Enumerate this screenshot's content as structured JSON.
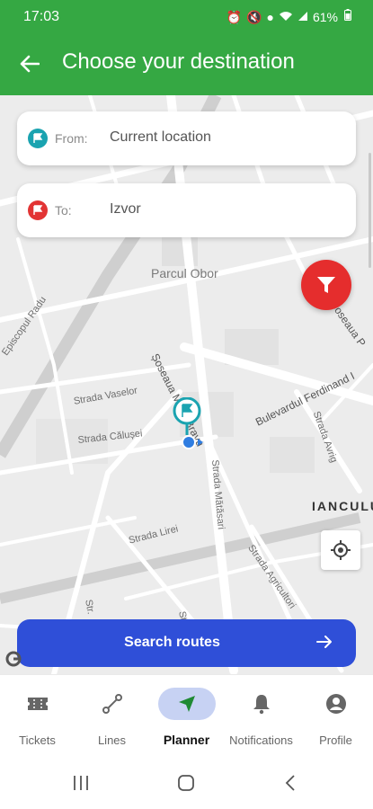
{
  "status_bar": {
    "time": "17:03",
    "battery": "61%"
  },
  "app_bar": {
    "title": "Choose your destination"
  },
  "from_field": {
    "label": "From:",
    "value": "Current location"
  },
  "to_field": {
    "label": "To:",
    "value": "Izvor"
  },
  "map": {
    "labels": {
      "park": "Parcul Obor",
      "street_mihai_bravu": "Șoseaua Mihai Bravu",
      "street_ferdinand": "Bulevardul Ferdinand I",
      "street_vaselor": "Strada Vaselor",
      "street_calusei": "Strada Călușei",
      "street_lirei": "Strada Lirei",
      "street_matasari": "Strada Mătăsari",
      "street_agricultori": "Strada Agricultori",
      "street_avrig": "Strada Avrig",
      "street_episcopul": "Episcopul Radu",
      "area_iancului": "IANCULU",
      "street_sosea_partial": "Șoseaua P",
      "street_st1": "Str.",
      "street_st2": "St"
    }
  },
  "search_button": {
    "label": "Search routes"
  },
  "bottom_nav": {
    "items": [
      {
        "label": "Tickets",
        "icon": "ticket-icon",
        "active": false
      },
      {
        "label": "Lines",
        "icon": "route-icon",
        "active": false
      },
      {
        "label": "Planner",
        "icon": "navigation-icon",
        "active": true
      },
      {
        "label": "Notifications",
        "icon": "bell-icon",
        "active": false
      },
      {
        "label": "Profile",
        "icon": "profile-icon",
        "active": false
      }
    ]
  },
  "colors": {
    "brand_green": "#35a843",
    "accent_blue": "#2f4fd8",
    "filter_red": "#e52d2d",
    "from_teal": "#1aa3b0",
    "to_red": "#e23434",
    "nav_active_bg": "#c7d2f3"
  }
}
